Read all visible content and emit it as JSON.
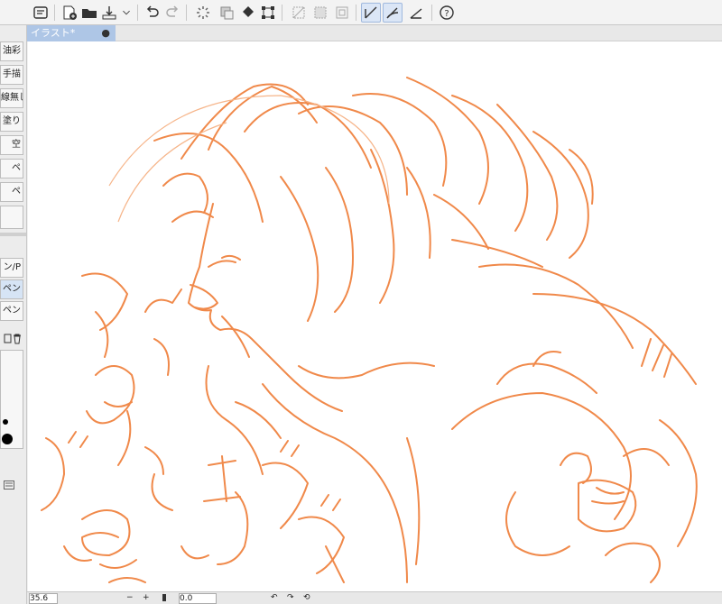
{
  "document_tab": {
    "title": "イラスト*",
    "modified_mark": "●"
  },
  "left_panel": {
    "tools": [
      "油彩",
      "手描",
      "線無し",
      "塗り",
      "空",
      "ペ",
      "ペ",
      "",
      ""
    ],
    "subtools": [
      "ン/P",
      "ペン",
      "ペン"
    ]
  },
  "status_bar": {
    "zoom": "35.6",
    "minus": "−",
    "plus": "+",
    "angle": "0.0"
  },
  "toolbar_icons": [
    "clip-studio-icon",
    "new-canvas-icon",
    "open-folder-icon",
    "export-icon",
    "undo-icon",
    "redo-icon",
    "loading-icon",
    "clear-icon",
    "fill-icon",
    "transform-icon",
    "deselect-icon",
    "invert-selection-icon",
    "selection-border-icon",
    "snap-ruler-icon",
    "snap-special-ruler-icon",
    "snap-grid-icon",
    "help-icon"
  ],
  "colors": {
    "stroke": "#f0894a",
    "accent": "#aec6e6"
  }
}
